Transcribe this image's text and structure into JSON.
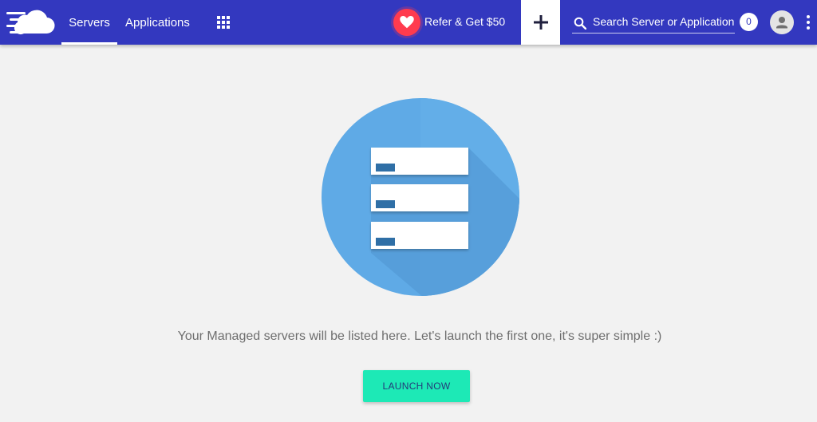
{
  "topbar": {
    "logo_icon": "cloud-logo-icon",
    "nav": [
      {
        "label": "Servers",
        "active": true
      },
      {
        "label": "Applications",
        "active": false
      }
    ],
    "apps_grid_icon": "grid-icon",
    "refer_label": "Refer & Get $50",
    "refer_icon": "heart-icon",
    "add_icon": "plus-icon",
    "search_placeholder": "Search Server or Application",
    "search_icon": "search-icon",
    "notification_count": "0",
    "avatar_icon": "user-avatar-icon",
    "menu_icon": "more-vertical-icon"
  },
  "main": {
    "illustration_icon": "server-stack-icon",
    "empty_message": "Your Managed servers will be listed here. Let's launch the first one, it's super simple :)",
    "launch_button_label": "LAUNCH NOW"
  },
  "colors": {
    "topbar_bg": "#3338bf",
    "accent_button": "#1de9b6",
    "heart_badge": "#ff3b4e",
    "illustration_blue": "#5faae6",
    "page_bg": "#f2f2f2"
  }
}
